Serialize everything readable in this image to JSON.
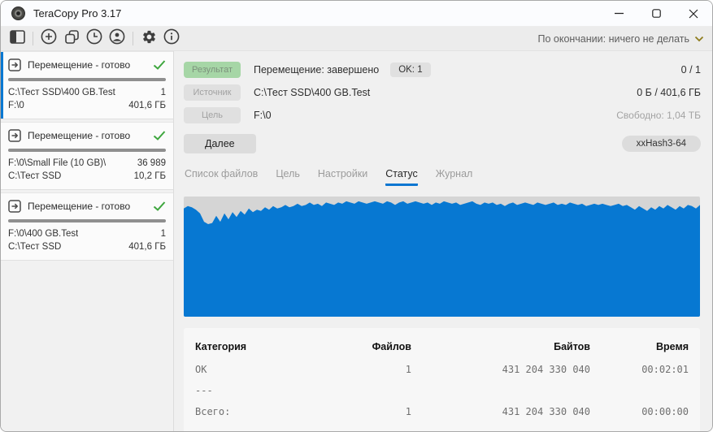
{
  "window": {
    "title": "TeraCopy Pro 3.17",
    "controls": [
      "minimize",
      "maximize",
      "close"
    ]
  },
  "toolbar": {
    "icons": [
      "sidebar-toggle",
      "add-task",
      "copy",
      "history",
      "account",
      "settings",
      "info"
    ],
    "finish_dropdown": "По окончании: ничего не делать"
  },
  "sidebar": {
    "tasks": [
      {
        "title": "Перемещение - готово",
        "rows": [
          {
            "left": "C:\\Тест SSD\\400 GB.Test",
            "right": "1"
          },
          {
            "left": "F:\\0",
            "right": "401,6 ГБ"
          }
        ]
      },
      {
        "title": "Перемещение - готово",
        "rows": [
          {
            "left": "F:\\0\\Small File (10 GB)\\",
            "right": "36 989"
          },
          {
            "left": "C:\\Тест SSD",
            "right": "10,2 ГБ"
          }
        ]
      },
      {
        "title": "Перемещение - готово",
        "rows": [
          {
            "left": "F:\\0\\400 GB.Test",
            "right": "1"
          },
          {
            "left": "C:\\Тест SSD",
            "right": "401,6 ГБ"
          }
        ]
      }
    ]
  },
  "summary": {
    "result_label": "Результат",
    "result_value": "Перемещение: завершено",
    "ok_badge": "OK: 1",
    "counter": "0 / 1",
    "source_label": "Источник",
    "source_value": "C:\\Тест SSD\\400 GB.Test",
    "bytes": "0 Б / 401,6 ГБ",
    "target_label": "Цель",
    "target_value": "F:\\0",
    "free_space": "Свободно: 1,04 ТБ",
    "next_button": "Далее",
    "hash_button": "xxHash3-64"
  },
  "tabs": [
    {
      "label": "Список файлов",
      "active": false
    },
    {
      "label": "Цель",
      "active": false
    },
    {
      "label": "Настройки",
      "active": false
    },
    {
      "label": "Статус",
      "active": true
    },
    {
      "label": "Журнал",
      "active": false
    }
  ],
  "chart_data": {
    "type": "area",
    "title": "График скорости передачи на вкладке Статус",
    "ylim": [
      0,
      100
    ],
    "grid": false,
    "fill_color": "#0778d2",
    "bg_color": "#d5d5d5",
    "values": [
      90,
      92,
      91,
      89,
      86,
      79,
      77,
      78,
      84,
      79,
      86,
      81,
      87,
      83,
      88,
      85,
      90,
      87,
      89,
      88,
      91,
      89,
      92,
      90,
      91,
      93,
      91,
      92,
      94,
      92,
      93,
      95,
      93,
      94,
      92,
      95,
      94,
      93,
      95,
      94,
      96,
      95,
      94,
      96,
      95,
      94,
      95,
      96,
      95,
      94,
      96,
      95,
      93,
      95,
      96,
      94,
      95,
      96,
      95,
      94,
      95,
      93,
      95,
      94,
      96,
      95,
      94,
      95,
      93,
      94,
      95,
      96,
      94,
      93,
      95,
      94,
      95,
      93,
      94,
      92,
      94,
      95,
      93,
      94,
      95,
      94,
      93,
      95,
      94,
      93,
      94,
      95,
      93,
      94,
      93,
      95,
      94,
      93,
      94,
      92,
      93,
      94,
      93,
      94,
      93,
      92,
      93,
      94,
      92,
      93,
      91,
      89,
      92,
      90,
      88,
      91,
      89,
      92,
      90,
      93,
      91,
      89,
      92,
      90,
      93,
      92,
      90,
      93
    ]
  },
  "stats": {
    "headers": [
      "Категория",
      "Файлов",
      "Байтов",
      "Время"
    ],
    "rows": [
      [
        "OK",
        "1",
        "431 204 330 040",
        "00:02:01"
      ],
      [
        "---",
        "",
        "",
        ""
      ],
      [
        "Всего:",
        "1",
        "431 204 330 040",
        "00:00:00"
      ]
    ]
  },
  "colors": {
    "accent_blue": "#0778d2",
    "success_green": "#3ea63e",
    "result_pill_green": "#a6d6a6",
    "chevron_gold": "#8f7d1e"
  }
}
